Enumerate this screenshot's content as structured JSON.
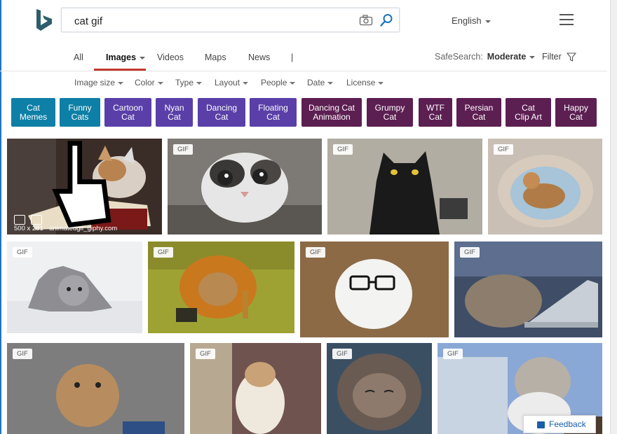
{
  "search": {
    "query": "cat gif"
  },
  "header": {
    "language": "English"
  },
  "nav": {
    "tabs": [
      {
        "label": "All"
      },
      {
        "label": "Images"
      },
      {
        "label": "Videos"
      },
      {
        "label": "Maps"
      },
      {
        "label": "News"
      }
    ],
    "separator": "|",
    "safesearch_label": "SafeSearch:",
    "safesearch_value": "Moderate",
    "filter_label": "Filter"
  },
  "filters": [
    "Image size",
    "Color",
    "Type",
    "Layout",
    "People",
    "Date",
    "License"
  ],
  "chips": [
    {
      "line1": "Cat",
      "line2": "Memes",
      "color": "#0e7fa6"
    },
    {
      "line1": "Funny",
      "line2": "Cats",
      "color": "#0e7fa6"
    },
    {
      "line1": "Cartoon",
      "line2": "Cat",
      "color": "#5a3fa8"
    },
    {
      "line1": "Nyan",
      "line2": "Cat",
      "color": "#5a3fa8"
    },
    {
      "line1": "Dancing",
      "line2": "Cat",
      "color": "#5a3fa8"
    },
    {
      "line1": "Floating",
      "line2": "Cat",
      "color": "#5a3fa8"
    },
    {
      "line1": "Dancing Cat",
      "line2": "Animation",
      "color": "#5c1f52"
    },
    {
      "line1": "Grumpy",
      "line2": "Cat",
      "color": "#5c1f52"
    },
    {
      "line1": "WTF",
      "line2": "Cat",
      "color": "#5c1f52"
    },
    {
      "line1": "Persian",
      "line2": "Cat",
      "color": "#5c1f52"
    },
    {
      "line1": "Cat",
      "line2": "Clip Art",
      "color": "#5c1f52"
    },
    {
      "line1": "Happy",
      "line2": "Cat",
      "color": "#5c1f52"
    }
  ],
  "images": {
    "badge": "GIF",
    "first_meta": "500 x 281 · animatedgif_giphy.com"
  },
  "feedback": "Feedback"
}
